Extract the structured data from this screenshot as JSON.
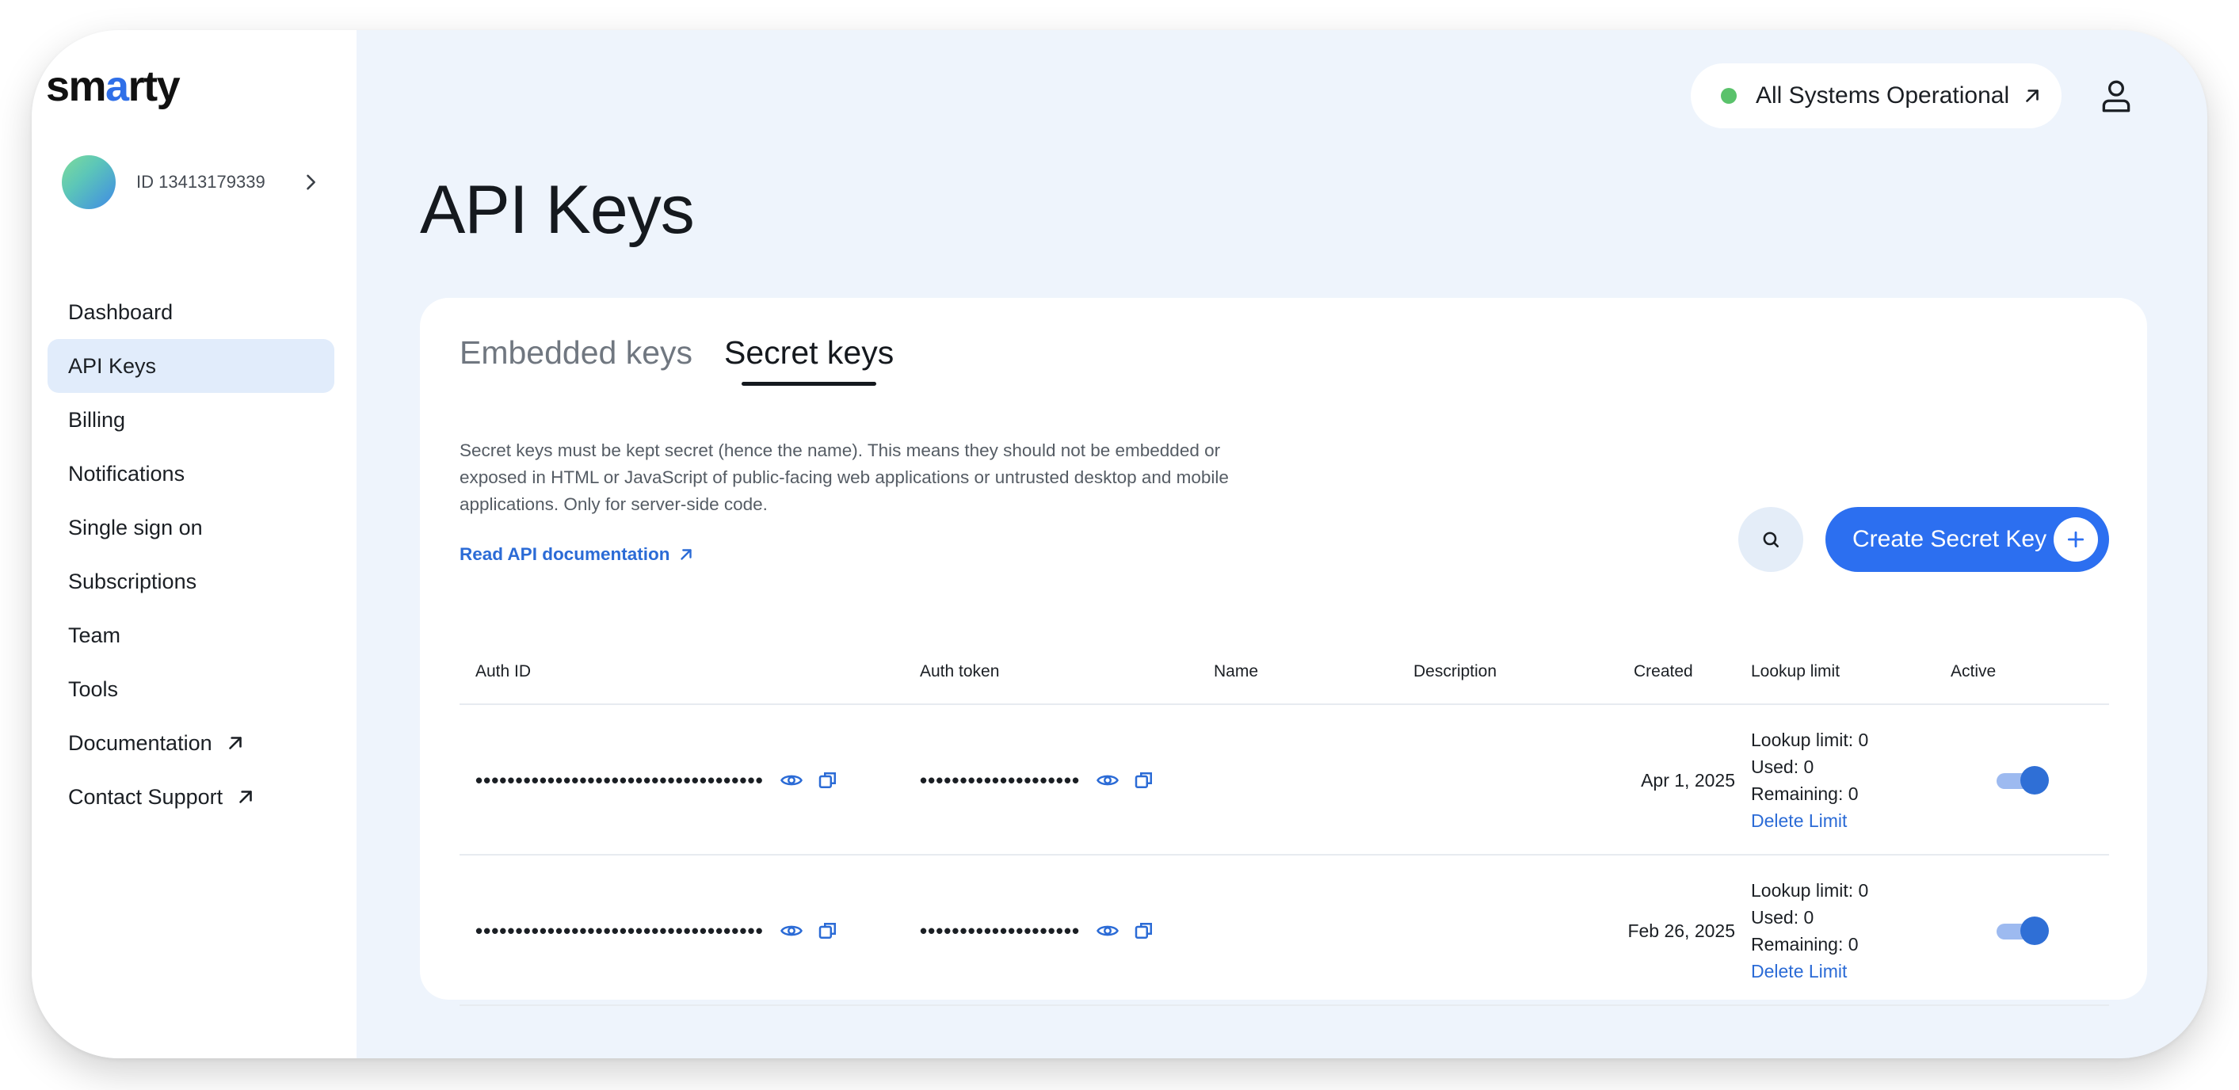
{
  "sidebar": {
    "logo_text_pre": "sm",
    "logo_text_dot": "a",
    "logo_text_post": "rty",
    "account_id": "ID 13413179339",
    "items": [
      {
        "label": "Dashboard",
        "active": false,
        "external": false
      },
      {
        "label": "API Keys",
        "active": true,
        "external": false
      },
      {
        "label": "Billing",
        "active": false,
        "external": false
      },
      {
        "label": "Notifications",
        "active": false,
        "external": false
      },
      {
        "label": "Single sign on",
        "active": false,
        "external": false
      },
      {
        "label": "Subscriptions",
        "active": false,
        "external": false
      },
      {
        "label": "Team",
        "active": false,
        "external": false
      },
      {
        "label": "Tools",
        "active": false,
        "external": false
      },
      {
        "label": "Documentation",
        "active": false,
        "external": true
      },
      {
        "label": "Contact Support",
        "active": false,
        "external": true
      }
    ]
  },
  "header": {
    "status_text": "All Systems Operational",
    "status_color": "#5ac26b"
  },
  "page": {
    "title": "API Keys"
  },
  "tabs": [
    {
      "label": "Embedded keys",
      "active": false
    },
    {
      "label": "Secret keys",
      "active": true
    }
  ],
  "description": {
    "text": "Secret keys must be kept secret (hence the name). This means they should not be embedded or exposed in HTML or JavaScript of public-facing web applications or untrusted desktop and mobile applications. Only for server-side code.",
    "link_label": "Read API documentation"
  },
  "actions": {
    "create_label": "Create Secret Key"
  },
  "table": {
    "headers": {
      "auth_id": "Auth ID",
      "auth_token": "Auth token",
      "name": "Name",
      "description": "Description",
      "created": "Created",
      "lookup_limit": "Lookup limit",
      "active": "Active"
    },
    "rows": [
      {
        "auth_id_masked": "••••••••••••••••••••••••••••••••••••",
        "auth_token_masked": "••••••••••••••••••••",
        "name": "",
        "description": "",
        "created": "Apr 1, 2025",
        "lookup_limit": "Lookup limit: 0",
        "used": "Used: 0",
        "remaining": "Remaining: 0",
        "delete_label": "Delete Limit",
        "active": true
      },
      {
        "auth_id_masked": "••••••••••••••••••••••••••••••••••••",
        "auth_token_masked": "••••••••••••••••••••",
        "name": "",
        "description": "",
        "created": "Feb 26, 2025",
        "lookup_limit": "Lookup limit: 0",
        "used": "Used: 0",
        "remaining": "Remaining: 0",
        "delete_label": "Delete Limit",
        "active": true
      }
    ]
  },
  "colors": {
    "accent": "#2c6ff0",
    "link": "#2b6bd6",
    "background": "#eef4fc"
  }
}
